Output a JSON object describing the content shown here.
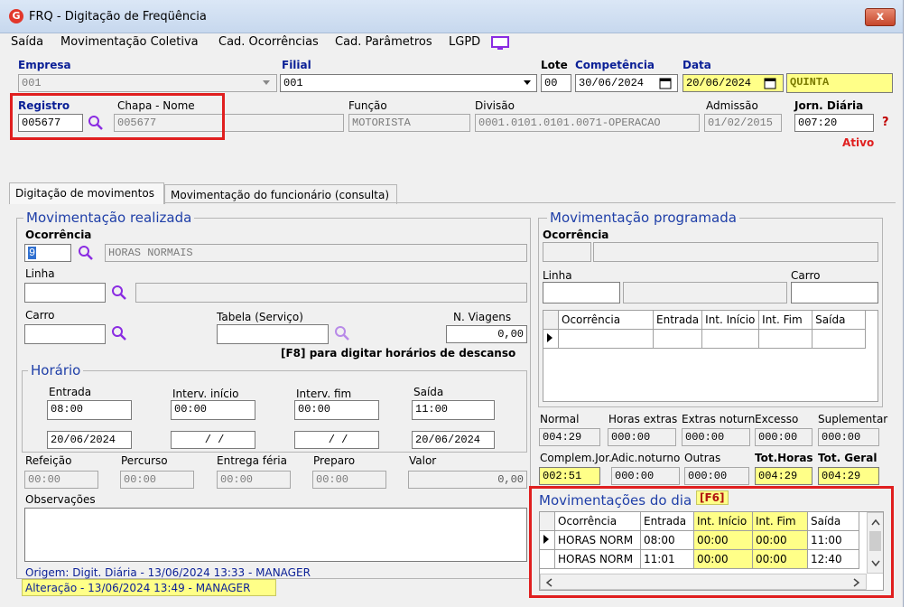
{
  "window": {
    "title": "FRQ - Digitação de Freqüência",
    "close_label": "x"
  },
  "menu": [
    "Saída",
    "Movimentação Coletiva",
    "Cad. Ocorrências",
    "Cad. Parâmetros",
    "LGPD"
  ],
  "header": {
    "empresa_label": "Empresa",
    "empresa_value": "001",
    "filial_label": "Filial",
    "filial_value": "001",
    "lote_label": "Lote",
    "lote_value": "00",
    "competencia_label": "Competência",
    "competencia_value": "30/06/2024",
    "data_label": "Data",
    "data_value": "20/06/2024",
    "weekday": "QUINTA",
    "registro_label": "Registro",
    "registro_value": "005677",
    "chapa_label": "Chapa  -  Nome",
    "chapa_value": "005677",
    "funcao_label": "Função",
    "funcao_value": "MOTORISTA",
    "divisao_label": "Divisão",
    "divisao_value": "0001.0101.0101.0071-OPERACAO",
    "admissao_label": "Admissão",
    "admissao_value": "01/02/2015",
    "jornada_label": "Jorn. Diária",
    "jornada_value": "007:20",
    "help_label": "?",
    "status": "Ativo"
  },
  "tabs": [
    "Digitação de movimentos",
    "Movimentação do funcionário (consulta)"
  ],
  "realizada": {
    "title": "Movimentação realizada",
    "ocorrencia_label": "Ocorrência",
    "ocorrencia_code": "9",
    "ocorrencia_desc": "HORAS NORMAIS",
    "linha_label": "Linha",
    "carro_label": "Carro",
    "tabela_label": "Tabela (Serviço)",
    "viagens_label": "N. Viagens",
    "viagens_value": "0,00",
    "f8_hint": "[F8] para digitar horários de descanso",
    "horario_title": "Horário",
    "entrada_label": "Entrada",
    "entrada_value": "08:00",
    "entrada_date": "20/06/2024",
    "ini_label": "Interv. início",
    "ini_value": "00:00",
    "ini_date": "/ /",
    "fim_label": "Interv. fim",
    "fim_value": "00:00",
    "fim_date": "/ /",
    "saida_label": "Saída",
    "saida_value": "11:00",
    "saida_date": "20/06/2024",
    "refeicao_label": "Refeição",
    "refeicao_value": "00:00",
    "percurso_label": "Percurso",
    "percurso_value": "00:00",
    "entrega_label": "Entrega féria",
    "entrega_value": "00:00",
    "preparo_label": "Preparo",
    "preparo_value": "00:00",
    "valor_label": "Valor",
    "valor_value": "0,00",
    "obs_label": "Observações",
    "origem": "Origem: Digit. Diária - 13/06/2024 13:33 - MANAGER",
    "alteracao": "Alteração - 13/06/2024 13:49 - MANAGER"
  },
  "programada": {
    "title": "Movimentação programada",
    "ocorrencia_label": "Ocorrência",
    "linha_label": "Linha",
    "carro_label": "Carro",
    "grid_headers": [
      "Ocorrência",
      "Entrada",
      "Int. Início",
      "Int. Fim",
      "Saída"
    ]
  },
  "totals": {
    "normal_label": "Normal",
    "normal_value": "004:29",
    "extras_label": "Horas extras",
    "extras_value": "000:00",
    "extras_not_label": "Extras noturn.",
    "extras_not_value": "000:00",
    "excesso_label": "Excesso",
    "excesso_value": "000:00",
    "suplementar_label": "Suplementar",
    "suplementar_value": "000:00",
    "compl_label": "Complem.Jor.",
    "compl_value": "002:51",
    "adic_label": "Adic.noturno",
    "adic_value": "000:00",
    "outras_label": "Outras",
    "outras_value": "000:00",
    "tothoras_label": "Tot.Horas",
    "tothoras_value": "004:29",
    "totgeral_label": "Tot. Geral",
    "totgeral_value": "004:29"
  },
  "dia": {
    "title": "Movimentações do dia",
    "shortcut": "[F6]",
    "headers": [
      "Ocorrência",
      "Entrada",
      "Int. Início",
      "Int. Fim",
      "Saída"
    ],
    "rows": [
      [
        "HORAS NORM",
        "08:00",
        "00:00",
        "00:00",
        "11:00"
      ],
      [
        "HORAS NORM",
        "11:01",
        "00:00",
        "00:00",
        "12:40"
      ]
    ]
  },
  "colors": {
    "highlight_red": "#e01f1f",
    "yellow": "#ffff88",
    "group_title": "#1f3fa8",
    "status_red": "#e01f1f"
  },
  "icons": [
    "app-logo-icon",
    "close-icon",
    "monitor-icon",
    "search-icon",
    "calendar-icon",
    "dropdown-arrow-icon",
    "help-icon",
    "row-pointer-icon",
    "scroll-arrow-icon"
  ]
}
